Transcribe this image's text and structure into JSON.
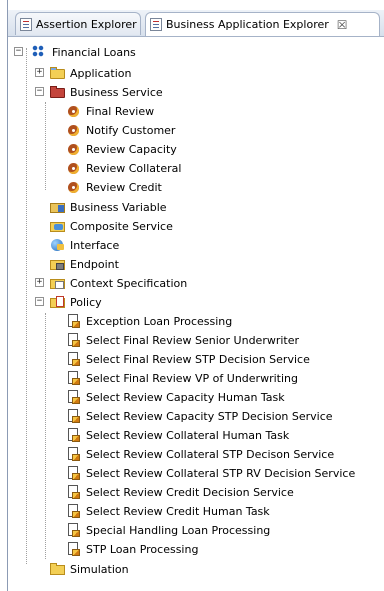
{
  "tabs": [
    {
      "label": "Assertion Explorer",
      "active": false
    },
    {
      "label": "Business Application Explorer",
      "active": true,
      "close": "☒"
    }
  ],
  "tree": {
    "root": {
      "label": "Financial Loans",
      "state": "−",
      "icon": "grid-icon"
    },
    "nodes": [
      {
        "label": "Application",
        "state": "+",
        "icon": "folder-icon"
      },
      {
        "label": "Business Service",
        "state": "−",
        "icon": "business-service-folder-icon",
        "children": [
          "Final Review",
          "Notify Customer",
          "Review Capacity",
          "Review Collateral",
          "Review Credit"
        ]
      },
      {
        "label": "Business Variable",
        "icon": "business-variable-icon"
      },
      {
        "label": "Composite Service",
        "icon": "composite-service-icon"
      },
      {
        "label": "Interface",
        "icon": "interface-icon"
      },
      {
        "label": "Endpoint",
        "icon": "endpoint-icon"
      },
      {
        "label": "Context Specification",
        "state": "+",
        "icon": "context-specification-icon"
      },
      {
        "label": "Policy",
        "state": "−",
        "icon": "policy-folder-icon",
        "children": [
          "Exception Loan Processing",
          "Select Final Review Senior Underwriter",
          "Select Final Review STP Decision Service",
          "Select Final Review VP of Underwriting",
          "Select Review Capacity Human Task",
          "Select Review Capacity STP Decision Service",
          "Select Review Collateral Human Task",
          "Select Review Collateral STP Decison Service",
          "Select Review Collateral STP RV Decision Service",
          "Select Review Credit Decision Service",
          "Select Review Credit Human Task",
          "Special Handling Loan Processing",
          "STP Loan Processing"
        ]
      },
      {
        "label": "Simulation",
        "icon": "simulation-folder-icon"
      }
    ]
  }
}
